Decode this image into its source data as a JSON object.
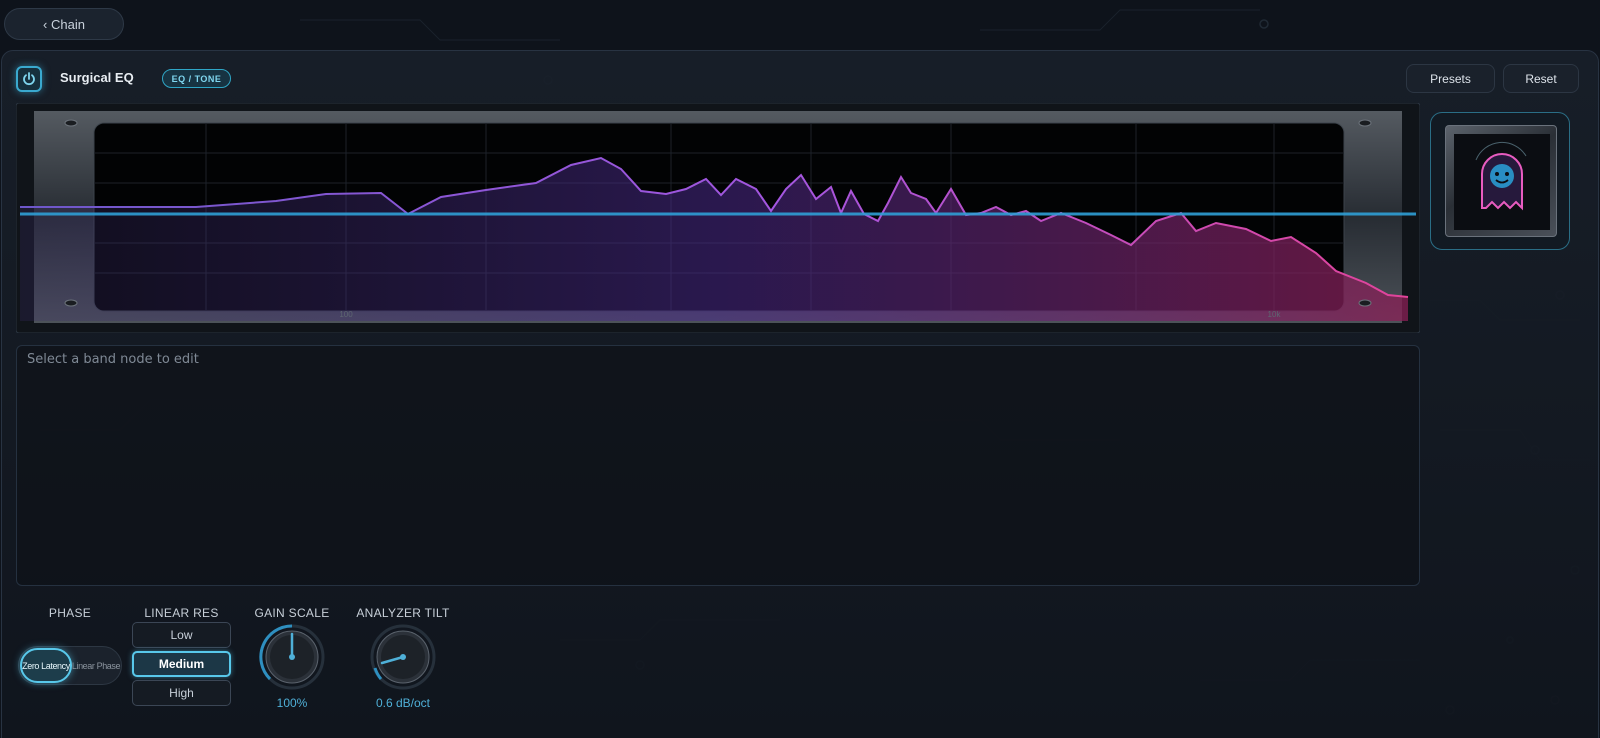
{
  "nav": {
    "back_label": "‹ Chain"
  },
  "header": {
    "title": "Surgical EQ",
    "category_tag": "EQ / TONE",
    "presets_label": "Presets",
    "reset_label": "Reset"
  },
  "spectrum": {
    "freq_labels": [
      "100",
      "10k"
    ],
    "line_color": "#2f9fd6",
    "gradient_start": "#7b5bd8",
    "gradient_end": "#e2449a"
  },
  "editor": {
    "hint": "Select a band node to edit"
  },
  "controls": {
    "phase": {
      "label": "PHASE",
      "options": [
        "Zero Latency",
        "Linear Phase"
      ],
      "selected": "Zero Latency"
    },
    "linear_res": {
      "label": "LINEAR RES",
      "options": [
        "Low",
        "Medium",
        "High"
      ],
      "selected": "Medium"
    },
    "gain_scale": {
      "label": "GAIN SCALE",
      "value": "100%"
    },
    "analyzer_tilt": {
      "label": "ANALYZER TILT",
      "value": "0.6 dB/oct"
    }
  },
  "colors": {
    "accent": "#58c8ea",
    "value_text": "#4fb0d8"
  },
  "icons": {
    "power": "power-icon",
    "thumbnail": "ghost-icon"
  }
}
